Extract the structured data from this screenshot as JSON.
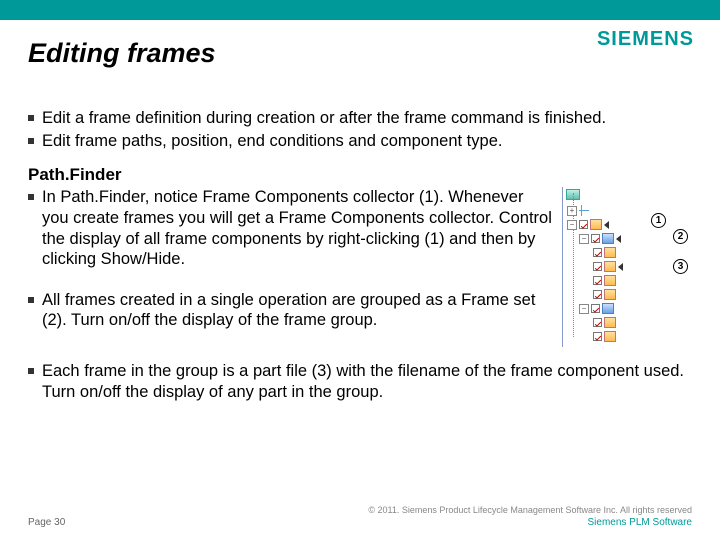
{
  "logo": "SIEMENS",
  "title": "Editing frames",
  "intro": {
    "b1": "Edit a frame definition during creation or after the frame command is finished.",
    "b2": "Edit frame paths, position, end conditions and component type."
  },
  "pathfinder": {
    "heading": "Path.Finder",
    "b1": "In Path.Finder, notice Frame Components collector (1). Whenever you create frames you will get a Frame Components collector. Control the display of all frame components by right-clicking (1) and then by clicking Show/Hide.",
    "b2": "All frames created in a single operation are grouped as a Frame set (2). Turn on/off the display of the frame group.",
    "b3": "Each frame in the group is a part file (3) with the filename of the frame component used. Turn on/off the display of any part in the group."
  },
  "callouts": {
    "c1": "1",
    "c2": "2",
    "c3": "3"
  },
  "footer": {
    "copyright": "© 2011. Siemens Product Lifecycle Management Software Inc. All rights reserved",
    "page": "Page 30",
    "brand": "Siemens PLM Software"
  }
}
